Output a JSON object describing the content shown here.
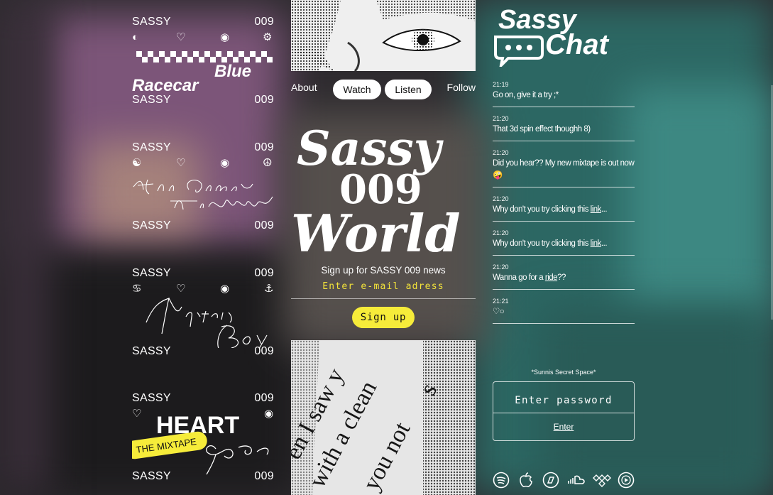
{
  "albums": [
    {
      "brand": "SASSY",
      "number": "009",
      "title": "Blue Racecar",
      "icons": [
        "half-circle-icon",
        "heart-icon",
        "target-icon",
        "triskelion-icon"
      ]
    },
    {
      "brand": "SASSY",
      "number": "009",
      "title": "Here Comes The Weekend",
      "icons": [
        "yin-yang-icon",
        "heart-icon",
        "target-icon",
        "peace-icon"
      ]
    },
    {
      "brand": "SASSY",
      "number": "009",
      "title": "Mystery Boy",
      "icons": [
        "cancer-sign-icon",
        "heart-icon",
        "target-icon",
        "anchor-icon"
      ]
    },
    {
      "brand": "SASSY",
      "number": "009",
      "title": "HEART ego",
      "tag": "THE MIXTAPE",
      "icons": [
        "heart-icon",
        "target-icon"
      ]
    }
  ],
  "nav": {
    "about": "About",
    "watch": "Watch",
    "listen": "Listen",
    "follow": "Follow"
  },
  "logo": {
    "line1": "Sassy",
    "line2": "009",
    "line3": "World"
  },
  "newsletter": {
    "label": "Sign up for SASSY 009 news",
    "placeholder": "Enter e-mail adress",
    "button": "Sign up"
  },
  "chat_logo": {
    "line1": "Sassy",
    "line2": "Chat"
  },
  "chat": [
    {
      "time": "21:19",
      "text": "Go on, give it a try ;*"
    },
    {
      "time": "21:20",
      "text": "That 3d spin effect thoughh 8)"
    },
    {
      "time": "21:20",
      "text": "Did you hear?? My new mixtape is out now🤪"
    },
    {
      "time": "21:20",
      "pre": "Why don't you try clicking this ",
      "link": "link",
      "post": "..."
    },
    {
      "time": "21:20",
      "pre": "Why don't you try clicking this ",
      "link": "link",
      "post": "..."
    },
    {
      "time": "21:20",
      "pre": "Wanna go for a ",
      "link": "ride",
      "post": "??"
    },
    {
      "time": "21:21",
      "text": "♡○"
    }
  ],
  "secret": {
    "label": "*Sunnis Secret Space*",
    "placeholder": "Enter password",
    "enter": "Enter"
  },
  "social": [
    "spotify-icon",
    "apple-music-icon",
    "deezer-icon",
    "soundcloud-icon",
    "tidal-icon",
    "youtube-music-icon"
  ],
  "colors": {
    "accent": "#f6ec3a",
    "text": "#ffffff"
  }
}
